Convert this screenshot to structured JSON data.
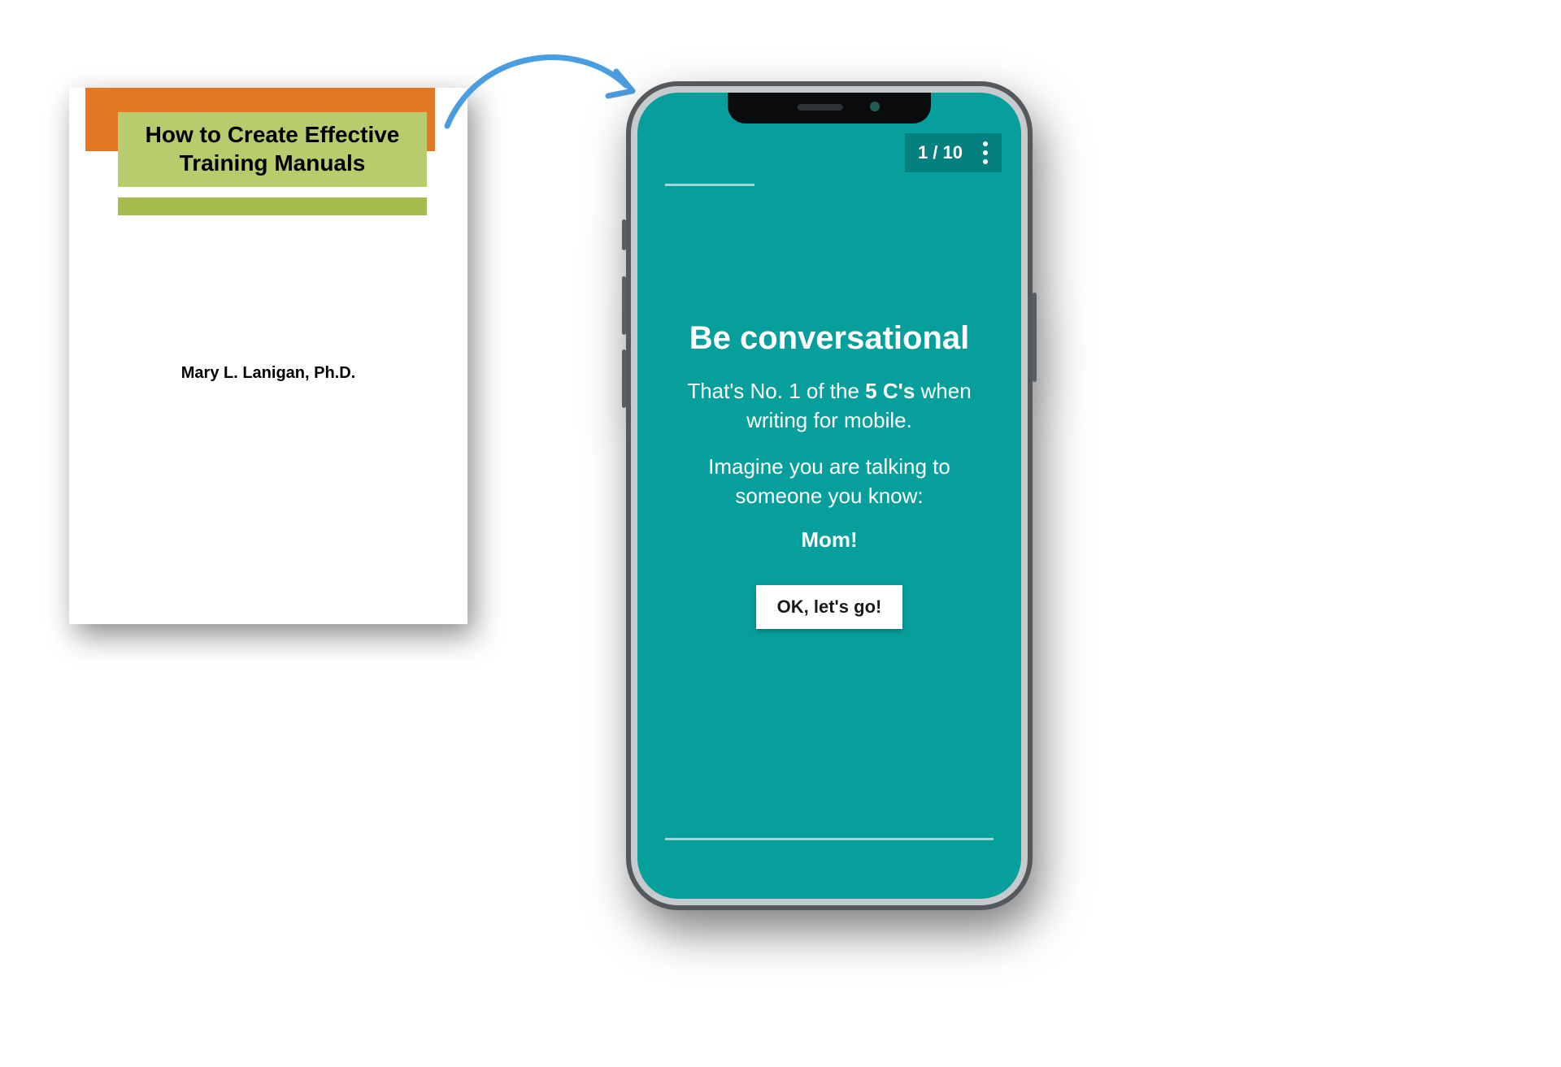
{
  "document_cover": {
    "title_line_1": "How to Create Effective",
    "title_line_2": "Training Manuals",
    "author": "Mary L. Lanigan, Ph.D.",
    "colors": {
      "accent_orange": "#e37924",
      "accent_olive": "#a6bc4d"
    }
  },
  "phone_app": {
    "page_indicator": "1 / 10",
    "headline": "Be conversational",
    "body_prefix": "That's No. 1 of the ",
    "body_strong": "5 C's",
    "body_suffix_line": " when writing for mobile.",
    "body_second": "Imagine you are talking to someone you know:",
    "emphasis": "Mom!",
    "cta_label": "OK, let's go!",
    "bg_color": "#069f9c"
  },
  "icons": {
    "kebab": "more-vertical-icon",
    "arrow": "curved-arrow-icon"
  }
}
